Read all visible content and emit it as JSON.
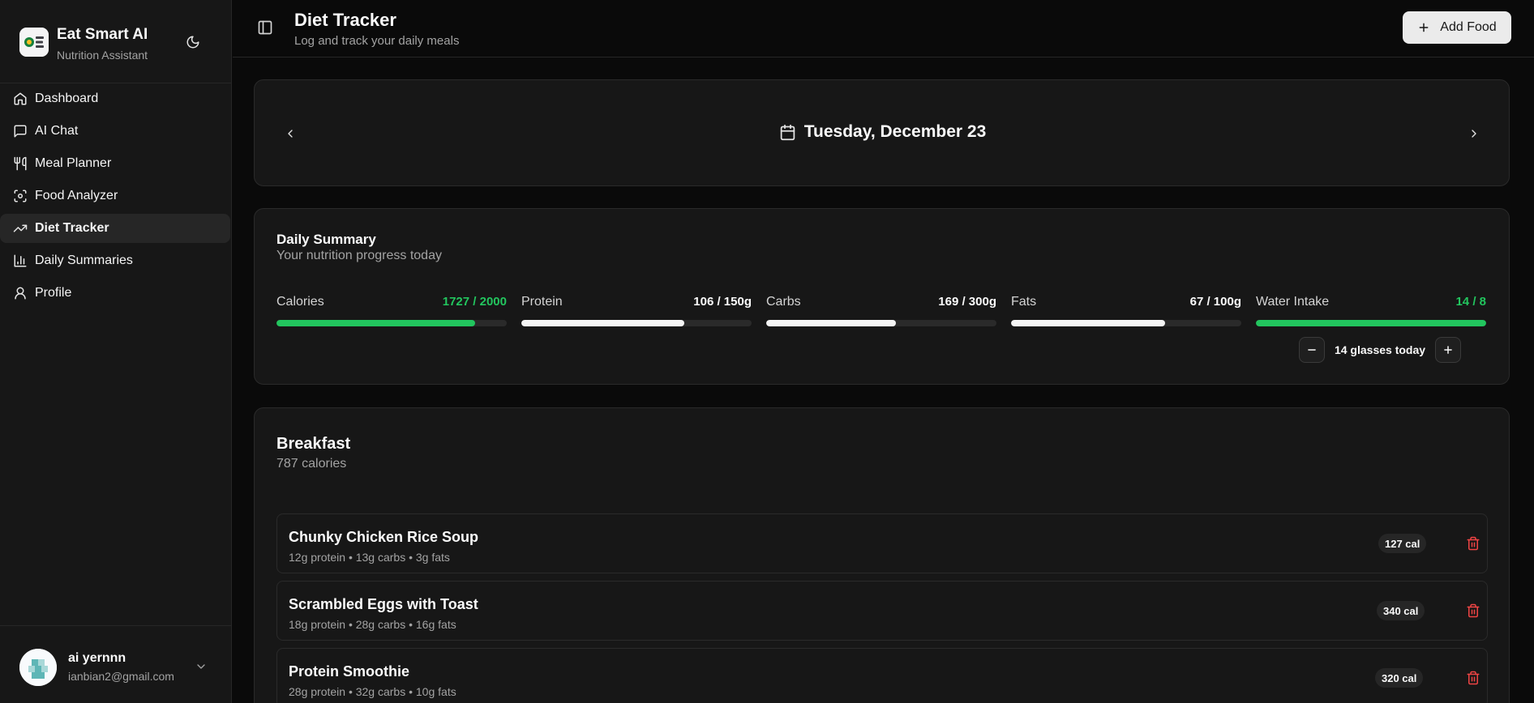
{
  "sidebar": {
    "app_name": "Eat Smart AI",
    "app_tagline": "Nutrition Assistant",
    "nav": [
      {
        "label": "Dashboard",
        "icon": "home-icon"
      },
      {
        "label": "AI Chat",
        "icon": "message-icon"
      },
      {
        "label": "Meal Planner",
        "icon": "utensils-icon"
      },
      {
        "label": "Food Analyzer",
        "icon": "scan-icon"
      },
      {
        "label": "Diet Tracker",
        "icon": "trending-up-icon",
        "active": true
      },
      {
        "label": "Daily Summaries",
        "icon": "bar-chart-icon"
      },
      {
        "label": "Profile",
        "icon": "user-icon"
      }
    ],
    "user": {
      "name": "ai yernnn",
      "email": "ianbian2@gmail.com"
    }
  },
  "header": {
    "title": "Diet Tracker",
    "subtitle": "Log and track your daily meals",
    "add_button": "Add Food"
  },
  "date_nav": {
    "date": "Tuesday, December 23"
  },
  "summary": {
    "title": "Daily Summary",
    "subtitle": "Your nutrition progress today",
    "metrics": [
      {
        "label": "Calories",
        "value": "1727 / 2000",
        "current": 1727,
        "goal": 2000,
        "color": "#22c55e"
      },
      {
        "label": "Protein",
        "value": "106 / 150g",
        "current": 106,
        "goal": 150,
        "color": "#f5f5f5"
      },
      {
        "label": "Carbs",
        "value": "169 / 300g",
        "current": 169,
        "goal": 300,
        "color": "#f5f5f5"
      },
      {
        "label": "Fats",
        "value": "67 / 100g",
        "current": 67,
        "goal": 100,
        "color": "#f5f5f5"
      },
      {
        "label": "Water Intake",
        "value": "14 / 8",
        "current": 14,
        "goal": 8,
        "color": "#22c55e"
      }
    ],
    "water_text": "14 glasses today"
  },
  "breakfast": {
    "title": "Breakfast",
    "calories": "787 calories",
    "items": [
      {
        "name": "Chunky Chicken Rice Soup",
        "macros": "12g protein • 13g carbs • 3g fats",
        "cal": "127 cal"
      },
      {
        "name": "Scrambled Eggs with Toast",
        "macros": "18g protein • 28g carbs • 16g fats",
        "cal": "340 cal"
      },
      {
        "name": "Protein Smoothie",
        "macros": "28g protein • 32g carbs • 10g fats",
        "cal": "320 cal"
      }
    ]
  },
  "colors": {
    "accent_green": "#22c55e",
    "danger": "#ef4444",
    "background": "#0a0a0a",
    "card": "#171717"
  }
}
